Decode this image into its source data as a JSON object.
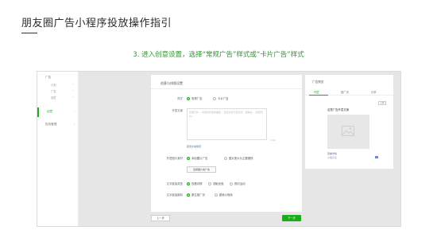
{
  "slide": {
    "title": "朋友圈广告小程序投放操作指引",
    "subtitle": "3. 进入创意设置，选择“常规广告”样式或“卡片广告”样式"
  },
  "sidebar": {
    "group_label": "广告",
    "sub_items": [
      "计划",
      "广告",
      "创意"
    ],
    "active_item": "创意",
    "second_item": "投放管理"
  },
  "form": {
    "header": "创意与排版设置",
    "style_label": "样式",
    "style_options": [
      "常规广告",
      "卡片广告"
    ],
    "copy_label": "外层文案",
    "copy_placeholder": "仅展示外... 请用创意语言描述... 建议文案不宜过长，控制在... 的范围内...",
    "copy_count": "0/40",
    "copy_link": "配置文案规范",
    "cover_label": "外层图片素材",
    "cover_options": [
      "添加图片广告",
      "图片宽大为主要展现"
    ],
    "cover_button": "选择图片或广告",
    "link_label": "文字链接类型",
    "link_options": [
      "查看详情",
      "领取优惠",
      "预约活动"
    ],
    "jump_label": "文字链接跳转",
    "jump_options": [
      "原生推广页",
      "跳转小程序"
    ],
    "prev_button": "上一步",
    "next_button": "下一步"
  },
  "preview": {
    "header": "广告预览",
    "tabs": [
      "外层",
      "推广页",
      "分享"
    ],
    "phone_button": "小屏",
    "card_title": "这是广告外层文案",
    "detail_link": "查看详情",
    "brand_text": "小程序名"
  },
  "colors": {
    "accent": "#1aad19",
    "subtitle": "#2c9a2c"
  }
}
